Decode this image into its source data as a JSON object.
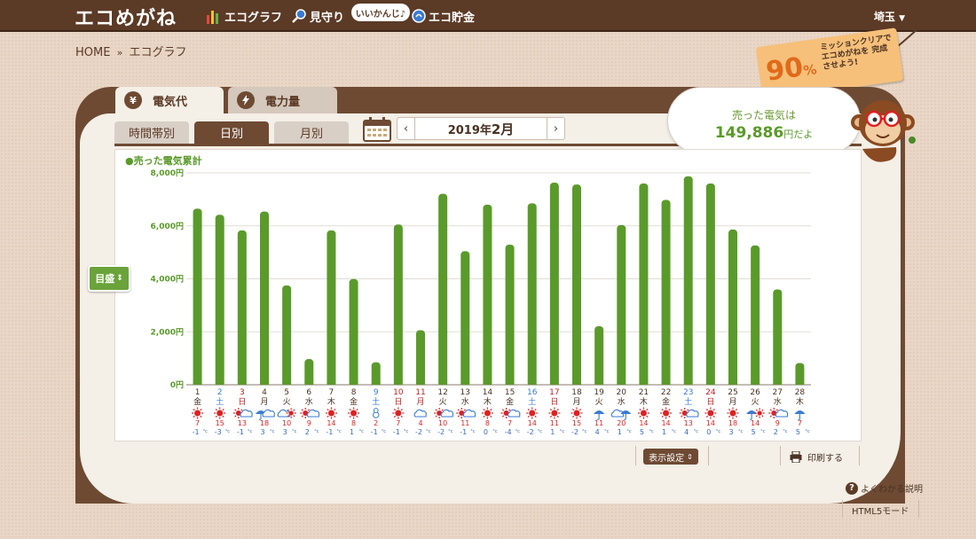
{
  "app": {
    "logo": "エコめがね"
  },
  "nav": {
    "items": [
      {
        "label": "エコグラフ",
        "icon": "bar-chart-icon"
      },
      {
        "label": "見守り",
        "icon": "magnifier-icon"
      },
      {
        "label": "エコ貯金",
        "icon": "coin-icon"
      }
    ],
    "bubble": "いいかんじ♪",
    "region": "埼玉"
  },
  "breadcrumb": {
    "home": "HOME",
    "sep": "»",
    "current": "エコグラフ"
  },
  "mission": {
    "percent": "90",
    "unit": "%",
    "text": "ミッションクリアで エコめがねを 完成させよう!"
  },
  "tabs": {
    "electricity_cost": "電気代",
    "electricity_amount": "電力量",
    "yen_icon": "¥"
  },
  "subtabs": {
    "hourly": "時間帯別",
    "daily": "日別",
    "monthly": "月別"
  },
  "date_nav": {
    "year": "2019年",
    "month": "2月",
    "prev": "‹",
    "next": "›"
  },
  "sold": {
    "title": "売った電気は",
    "value": "149,886",
    "suffix": "円だよ"
  },
  "target_button": {
    "label": "目盛",
    "arrow": "⇕"
  },
  "controls": {
    "display_settings": "表示設定",
    "display_arrow": "⇕",
    "print": "印刷する",
    "help": "よくわかる説明",
    "help_icon": "?",
    "html5": "HTML5モード"
  },
  "colors": {
    "bar": "#5a9a2a",
    "saturday": "#3a7bd5",
    "holiday": "#c02020",
    "weekday": "#4a3222",
    "frame": "#6e4a33"
  },
  "chart_data": {
    "type": "bar",
    "legend": "●売った電気累計",
    "ylim": [
      0,
      8000
    ],
    "y_ticks": [
      {
        "value": 0,
        "label": "0円"
      },
      {
        "value": 2000,
        "label": "2,000円"
      },
      {
        "value": 4000,
        "label": "4,000円"
      },
      {
        "value": 6000,
        "label": "6,000円"
      },
      {
        "value": 8000,
        "label": "8,000円"
      }
    ],
    "grid": true,
    "days": [
      "1",
      "2",
      "3",
      "4",
      "5",
      "6",
      "7",
      "8",
      "9",
      "10",
      "11",
      "12",
      "13",
      "14",
      "15",
      "16",
      "17",
      "18",
      "19",
      "20",
      "21",
      "22",
      "23",
      "24",
      "25",
      "26",
      "27",
      "28"
    ],
    "weekdays": [
      "金",
      "土",
      "日",
      "月",
      "火",
      "水",
      "木",
      "金",
      "土",
      "日",
      "月",
      "火",
      "水",
      "木",
      "金",
      "土",
      "日",
      "月",
      "火",
      "水",
      "木",
      "金",
      "土",
      "日",
      "月",
      "火",
      "水",
      "木"
    ],
    "day_types": [
      "w",
      "sat",
      "sun",
      "w",
      "w",
      "w",
      "w",
      "w",
      "sat",
      "sun",
      "hol",
      "w",
      "w",
      "w",
      "w",
      "sat",
      "sun",
      "w",
      "w",
      "w",
      "w",
      "w",
      "sat",
      "sun",
      "w",
      "w",
      "w",
      "w"
    ],
    "values": [
      6650,
      6420,
      5830,
      6540,
      3750,
      970,
      5830,
      3990,
      850,
      6050,
      2060,
      7210,
      5040,
      6800,
      5290,
      6850,
      7630,
      7560,
      2210,
      6030,
      7600,
      6980,
      7870,
      7600,
      5860,
      5260,
      3600,
      820
    ],
    "weather": [
      "sun",
      "sun",
      "sun-cloud",
      "rain-cloud",
      "cloud-sun",
      "sun-cloud",
      "sun",
      "sun",
      "snow",
      "sun",
      "cloud",
      "sun-cloud",
      "sun-cloud",
      "sun",
      "sun-cloud",
      "sun",
      "sun",
      "sun",
      "rain",
      "cloud-rain",
      "sun",
      "sun",
      "sun-cloud",
      "sun",
      "sun",
      "rain-sun",
      "sun-cloud",
      "rain"
    ],
    "temp_high": [
      "7",
      "15",
      "13",
      "18",
      "10",
      "9",
      "14",
      "8",
      "2",
      "7",
      "4",
      "10",
      "11",
      "8",
      "7",
      "14",
      "11",
      "15",
      "11",
      "20",
      "14",
      "14",
      "13",
      "14",
      "18",
      "14",
      "9",
      "7"
    ],
    "temp_low": [
      "-1",
      "-3",
      "-1",
      "3",
      "3",
      "2",
      "-1",
      "1",
      "-1",
      "-1",
      "-2",
      "-2",
      "-1",
      "0",
      "-4",
      "-2",
      "1",
      "-2",
      "4",
      "1",
      "5",
      "1",
      "4",
      "0",
      "3",
      "5",
      "2",
      "5"
    ],
    "temp_unit": "°c"
  }
}
